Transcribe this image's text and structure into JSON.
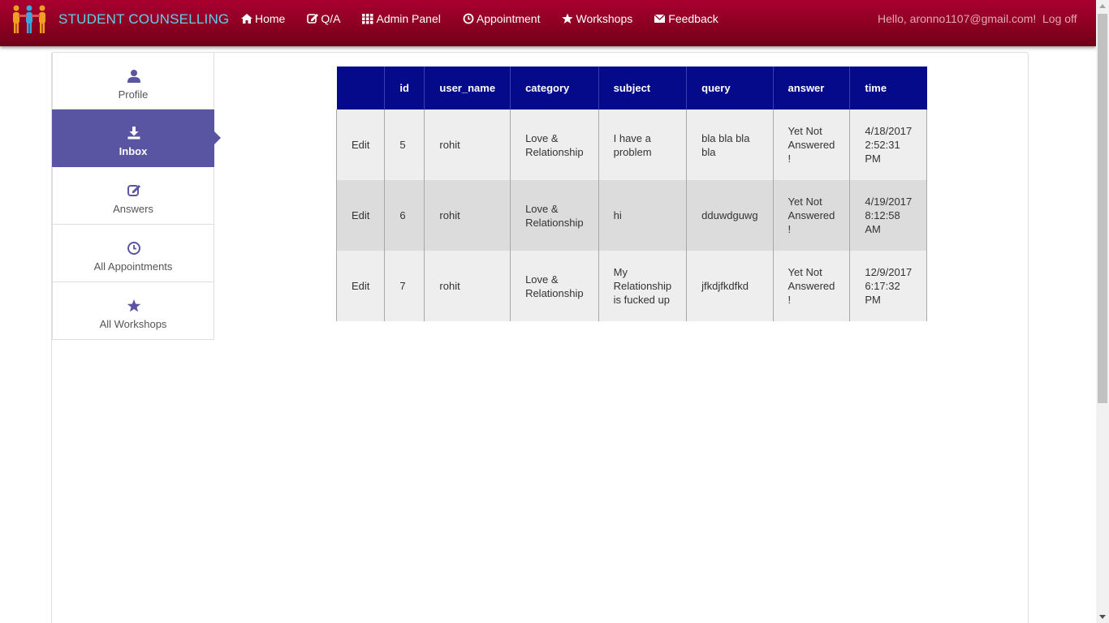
{
  "brand": {
    "title": "STUDENT COUNSELLING",
    "colors": {
      "navbar": "#8a0020",
      "brand_text": "#5dd0f0",
      "accent": "#5a55a3",
      "table_header": "#050a8a"
    }
  },
  "nav": {
    "items": [
      {
        "label": "Home",
        "icon": "home-icon"
      },
      {
        "label": "Q/A",
        "icon": "edit-icon"
      },
      {
        "label": "Admin Panel",
        "icon": "grid-icon"
      },
      {
        "label": "Appointment",
        "icon": "clock-icon"
      },
      {
        "label": "Workshops",
        "icon": "star-icon"
      },
      {
        "label": "Feedback",
        "icon": "envelope-icon"
      }
    ],
    "greeting": "Hello, aronno1107@gmail.com!",
    "logoff": "Log off"
  },
  "sidebar": {
    "items": [
      {
        "label": "Profile",
        "icon": "user-icon",
        "active": false
      },
      {
        "label": "Inbox",
        "icon": "download-icon",
        "active": true
      },
      {
        "label": "Answers",
        "icon": "edit-icon",
        "active": false
      },
      {
        "label": "All Appointments",
        "icon": "clock-icon",
        "active": false
      },
      {
        "label": "All Workshops",
        "icon": "star-icon",
        "active": false
      }
    ]
  },
  "table": {
    "headers": [
      "",
      "id",
      "user_name",
      "category",
      "subject",
      "query",
      "answer",
      "time"
    ],
    "rows": [
      {
        "action": "Edit",
        "id": "5",
        "user_name": "rohit",
        "category": "Love & Relationship",
        "subject": "I have a problem",
        "query": "bla bla bla bla",
        "answer": "Yet Not Answered !",
        "time": "4/18/2017 2:52:31 PM"
      },
      {
        "action": "Edit",
        "id": "6",
        "user_name": "rohit",
        "category": "Love & Relationship",
        "subject": "hi",
        "query": "dduwdguwg",
        "answer": "Yet Not Answered !",
        "time": "4/19/2017 8:12:58 AM"
      },
      {
        "action": "Edit",
        "id": "7",
        "user_name": "rohit",
        "category": "Love & Relationship",
        "subject": "My Relationship is fucked up",
        "query": "jfkdjfkdfkd",
        "answer": "Yet Not Answered !",
        "time": "12/9/2017 6:17:32 PM"
      }
    ]
  }
}
